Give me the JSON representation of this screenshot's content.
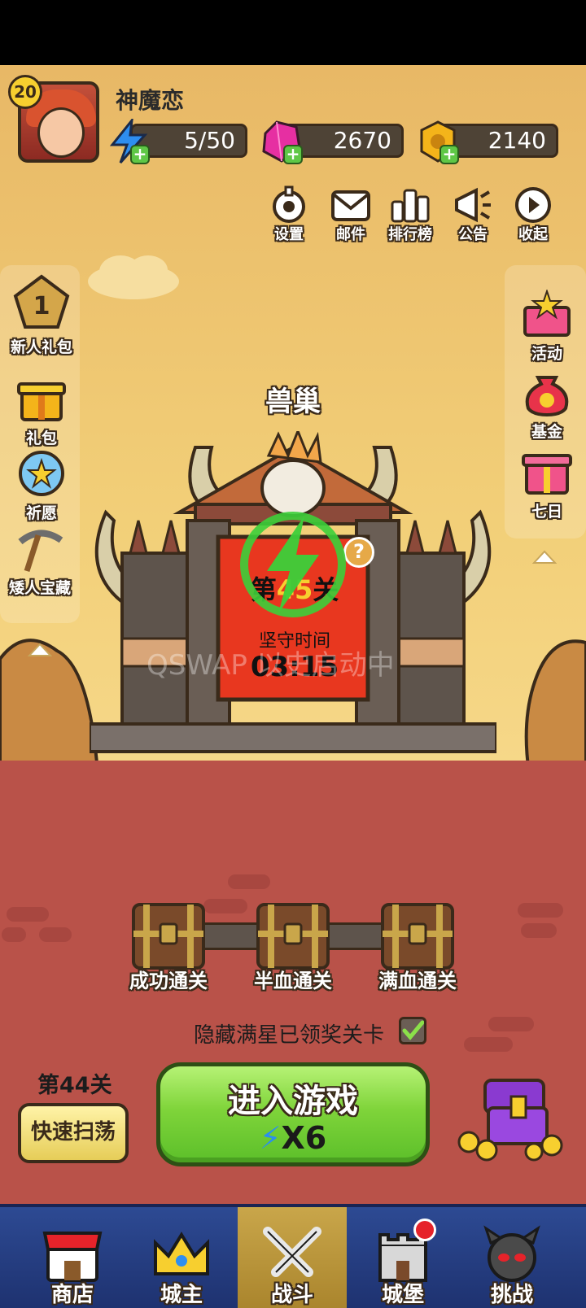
{
  "player": {
    "level": "20",
    "name": "神魔恋"
  },
  "resources": {
    "energy": "5/50",
    "gems": "2670",
    "coins": "2140"
  },
  "top_buttons": [
    {
      "label": "设置",
      "icon": "gear-icon"
    },
    {
      "label": "邮件",
      "icon": "mail-icon"
    },
    {
      "label": "排行榜",
      "icon": "leaderboard-icon"
    },
    {
      "label": "公告",
      "icon": "megaphone-icon"
    },
    {
      "label": "收起",
      "icon": "play-icon"
    }
  ],
  "left_side": [
    {
      "label": "新人礼包",
      "badge": "1",
      "icon": "pentagon-badge-icon"
    },
    {
      "label": "礼包",
      "icon": "gift-icon"
    },
    {
      "label": "祈愿",
      "icon": "star-orb-icon"
    },
    {
      "label": "矮人宝藏",
      "icon": "pickaxe-icon"
    }
  ],
  "right_side": [
    {
      "label": "活动",
      "icon": "star-gift-icon"
    },
    {
      "label": "基金",
      "icon": "money-bag-icon"
    },
    {
      "label": "七日",
      "icon": "gift-box-icon"
    }
  ],
  "stage": {
    "area_name": "兽巢",
    "stage_prefix": "第",
    "stage_number": "45",
    "stage_suffix": "关",
    "hold_label": "坚守时间",
    "hold_time": "03:15",
    "watermark": "QSWAP 以史启动中"
  },
  "chests": [
    {
      "label": "成功通关"
    },
    {
      "label": "半血通关"
    },
    {
      "label": "满血通关"
    }
  ],
  "hide_option": {
    "label": "隐藏满星已领奖关卡",
    "checked": true
  },
  "prev_stage": {
    "label": "第44关"
  },
  "sweep_button": {
    "label": "快速扫荡"
  },
  "enter_button": {
    "label": "进入游戏",
    "cost": "X6"
  },
  "bottom_nav": [
    {
      "label": "商店",
      "icon": "shop-icon",
      "active": false
    },
    {
      "label": "城主",
      "icon": "crown-icon",
      "active": false
    },
    {
      "label": "战斗",
      "icon": "crossed-swords-icon",
      "active": true
    },
    {
      "label": "城堡",
      "icon": "castle-icon",
      "active": false,
      "notify": true
    },
    {
      "label": "挑战",
      "icon": "demon-icon",
      "active": false
    }
  ],
  "colors": {
    "sky": "#f2cf78",
    "ground": "#b95249",
    "enter_button": "#7fd43a",
    "nav_bg": "#2d4a93",
    "nav_active": "#c9a64a",
    "energy_green": "#3ccf3a"
  }
}
